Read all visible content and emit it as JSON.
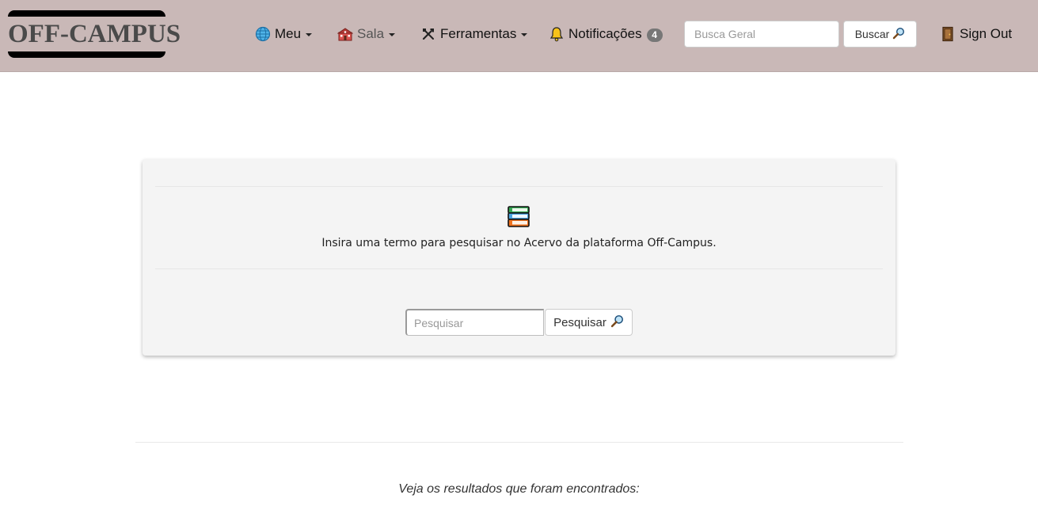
{
  "brand": {
    "logo_text": "OFF-CAMPUS"
  },
  "nav": {
    "meu": {
      "label": "Meu",
      "icon": "globe-icon"
    },
    "sala": {
      "label": "Sala",
      "icon": "school-building-icon"
    },
    "ferramentas": {
      "label": "Ferramentas",
      "icon": "tools-icon"
    },
    "notificacoes": {
      "label": "Notificações",
      "icon": "bell-icon",
      "count": "4"
    },
    "signout": {
      "label": "Sign Out",
      "icon": "door-icon"
    }
  },
  "top_search": {
    "placeholder": "Busca Geral",
    "value": "",
    "button_label": "Buscar",
    "button_icon": "magnifier-icon"
  },
  "panel": {
    "icon": "books-icon",
    "description": "Insira uma termo para pesquisar no Acervo da plataforma Off-Campus.",
    "search_placeholder": "Pesquisar",
    "search_value": "",
    "button_label": "Pesquisar",
    "button_icon": "magnifier-icon"
  },
  "results_text": "Veja os resultados que foram encontrados:",
  "colors": {
    "navbar_bg": "#c9b8b7",
    "badge_bg": "#777777",
    "panel_bg": "#f4f4f4"
  }
}
